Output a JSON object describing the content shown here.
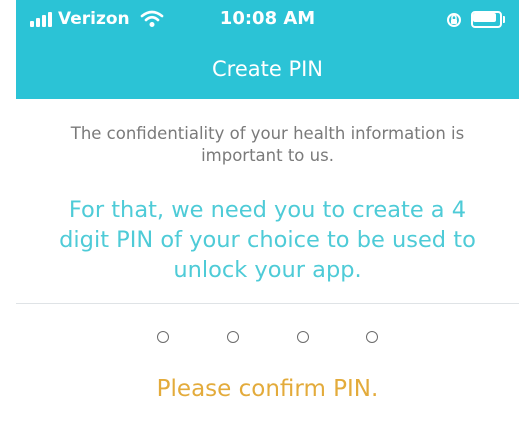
{
  "status_bar": {
    "carrier": "Verizon",
    "time": "10:08 AM"
  },
  "header": {
    "title": "Create PIN"
  },
  "message": {
    "confidentiality": "The confidentiality of your health information is important to us.",
    "instruction": "For that, we need you to create a 4 digit PIN of your choice to be used to unlock your app."
  },
  "pin": {
    "digits_entered": 0,
    "digits_total": 4,
    "status": "Please confirm PIN."
  },
  "colors": {
    "header": "#2bc3d6",
    "instruction": "#4ecbd7",
    "confirm": "#e3ab3b",
    "body_text": "#7a7a7a"
  },
  "icons": [
    "signal-icon",
    "wifi-icon",
    "orientation-lock-icon",
    "battery-icon"
  ]
}
